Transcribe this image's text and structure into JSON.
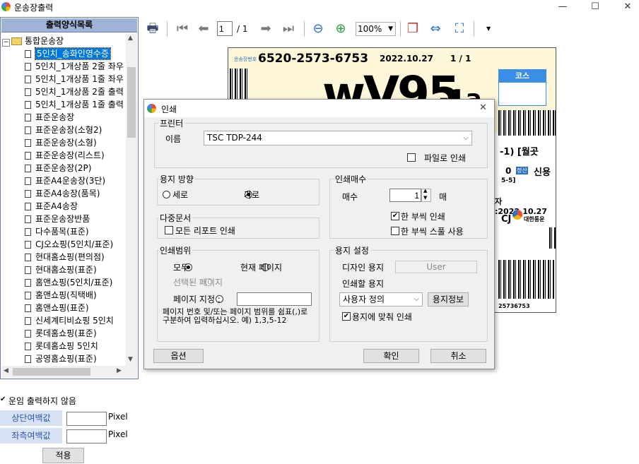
{
  "window": {
    "title": "운송장출력",
    "minimize_glyph": "—",
    "maximize_glyph": "☐",
    "close_glyph": "✕"
  },
  "tree": {
    "header": "출력양식목록",
    "root_label": "통합운송장",
    "items": [
      "5인치_송화인영수증",
      "5인치_1개상품 2줄 좌우",
      "5인치_1개상품 1줄 좌우",
      "5인치_1개상품 2줄 출력",
      "5인치_1개상품 1줄 출력",
      "표준운송장",
      "표준운송장(소형2)",
      "표준운송장(소형)",
      "표준운송장(리스트)",
      "표준운송장(2P)",
      "표준A4운송장(3단)",
      "표준A4송장(품목)",
      "표준A4송장",
      "표준운송장반품",
      "다수품목(표준)",
      "CJ오쇼핑(5인치/표준)",
      "현대홈쇼핑(편의점)",
      "현대홈쇼핑(표준)",
      "홈앤쇼핑(5인치/표준)",
      "홈앤쇼핑(직택배)",
      "홈앤쇼핑(표준)",
      "신세계티비쇼핑 5인치",
      "롯데홈쇼핑(표준)",
      "롯데홈쇼핑 5인치",
      "공영홈쇼핑(표준)"
    ],
    "selected_index": 0
  },
  "bottom_left": {
    "no_fare_print_label": "운임 출력하지 않음",
    "no_fare_checked": true,
    "top_margin_label": "상단여백값",
    "left_margin_label": "좌측여백값",
    "top_margin_value": "",
    "left_margin_value": "",
    "unit_top": "Pixel",
    "unit_left": "Pixel",
    "apply_button": "적용"
  },
  "toolbar": {
    "page_current": "1",
    "page_total": "/ 1",
    "zoom": "100%"
  },
  "label_preview": {
    "tracking_number": "6520-2573-6753",
    "date": "2022.10.27",
    "page": "1 / 1",
    "big_code": "wV95",
    "big_code_suffix": "-1a",
    "course_label": "코스",
    "mid_text": "-1) [월곳",
    "credit_amount": "0",
    "credit_badge": "정산",
    "credit_label": "신용",
    "number_5": "5-5]",
    "date_line": "자 :2022.10.27",
    "cj_brand": "CJ",
    "cj_company": "대한통운",
    "bottom_number": "25736753",
    "top_left_tag": "운송장번호"
  },
  "dialog": {
    "title": "인쇄",
    "close_glyph": "✕",
    "printer_group": "프린터",
    "name_label": "이름",
    "printer_name": "TSC TDP-244",
    "print_to_file_label": "파일로 인쇄",
    "print_to_file_checked": false,
    "orientation_group": "용지 방향",
    "portrait_label": "세로",
    "landscape_label": "가로",
    "orientation_selected": "landscape",
    "multidoc_group": "다중문서",
    "all_reports_label": "모든 리포트 인쇄",
    "all_reports_checked": false,
    "range_group": "인쇄범위",
    "range_all_label": "모두",
    "range_current_label": "현재 페이지",
    "range_selected_label": "선택된 페이지",
    "range_pages_label": "페이지 지정 :",
    "range_selected": "all",
    "range_pages_value": "",
    "range_help": "페이지 번호 및/또는 페이지 범위를 쉼표(,)로 구분하여 입력하십시오. 예) 1,3,5-12",
    "copies_group": "인쇄매수",
    "copies_label": "매수",
    "copies_value": "1",
    "copies_unit": "매",
    "collate_label": "한 부씩 인쇄",
    "collate_checked": true,
    "spool_label": "한 부씩 스풀 사용",
    "spool_checked": false,
    "paper_group": "용지 설정",
    "design_paper_label": "디자인 용지",
    "design_paper_value": "User",
    "print_paper_label": "인쇄할 용지",
    "print_paper_value": "사용자 정의",
    "paper_info_button": "용지정보",
    "fit_to_paper_label": "용지에 맞춰 인쇄",
    "fit_to_paper_checked": true,
    "options_button": "옵션",
    "ok_button": "확인",
    "cancel_button": "취소"
  },
  "colors": {
    "tree_header_bg": "#9fb3d6",
    "selected_item_bg": "#0078d7",
    "label_bg_beige": "#fdf6d8",
    "course_blue": "#3a8ee6"
  }
}
